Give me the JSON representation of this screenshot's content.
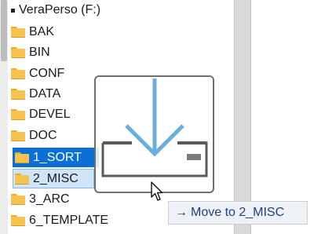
{
  "tree": {
    "drive": {
      "label": "VeraPerso (F:)"
    },
    "folders": [
      {
        "label": "BAK",
        "state": "normal"
      },
      {
        "label": "BIN",
        "state": "normal"
      },
      {
        "label": "CONF",
        "state": "normal"
      },
      {
        "label": "DATA",
        "state": "normal"
      },
      {
        "label": "DEVEL",
        "state": "normal"
      },
      {
        "label": "DOC",
        "state": "normal"
      },
      {
        "label": "1_SORT",
        "state": "selected"
      },
      {
        "label": "2_MISC",
        "state": "drop-target"
      },
      {
        "label": "3_ARC",
        "state": "normal"
      },
      {
        "label": "6_TEMPLATE",
        "state": "normal"
      }
    ]
  },
  "drag": {
    "icon": "move-into-tray-icon",
    "tooltip_arrow": "→",
    "tooltip_text": "Move to 2_MISC"
  },
  "colors": {
    "selection": "#0c6fd6",
    "drop_highlight": "#cfe4f8",
    "arrow": "#6aaede",
    "folder": "#f6c44e"
  }
}
